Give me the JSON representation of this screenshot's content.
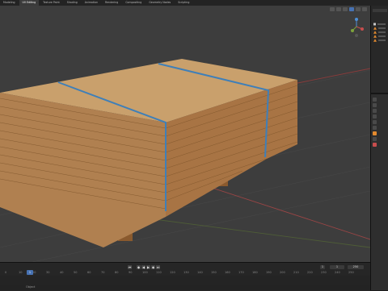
{
  "app": {
    "accent": "#4772b3"
  },
  "topbar": {
    "tabs": [
      "Modeling",
      "UV Editing",
      "Texture Paint",
      "Shading",
      "Animation",
      "Rendering",
      "Compositing",
      "Geometry Nodes",
      "Scripting"
    ],
    "active_tab": 1
  },
  "viewport": {
    "background": "#3d3d3d",
    "axis_x_color": "#b43c3c",
    "axis_y_color": "#6a8a2c",
    "model": {
      "name": "plywood pallet stack",
      "strap_color": "#3f7fb8",
      "wood_color": "#c79a63"
    },
    "gizmo": {
      "x_label": "X",
      "y_label": "Y",
      "z_label": "Z"
    }
  },
  "timeline": {
    "current_frame": "1",
    "start_label": "1",
    "end_label": "250",
    "ruler": [
      "0",
      "10",
      "20",
      "30",
      "40",
      "50",
      "60",
      "70",
      "80",
      "90",
      "100",
      "110",
      "120",
      "130",
      "140",
      "150",
      "160",
      "170",
      "180",
      "190",
      "200",
      "210",
      "220",
      "230",
      "240",
      "250"
    ]
  },
  "statusbar": {
    "text": "Object"
  }
}
